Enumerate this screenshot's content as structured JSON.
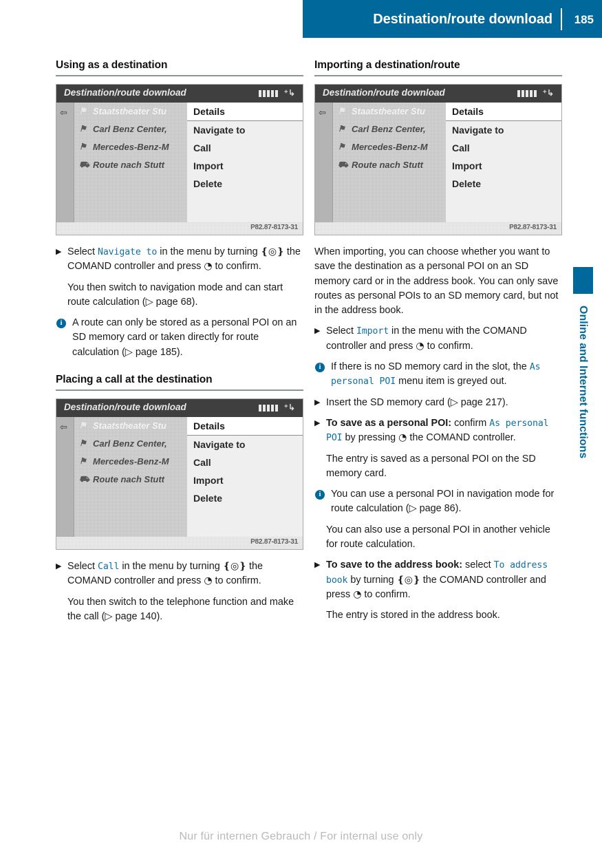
{
  "header": {
    "title": "Destination/route download",
    "page_number": "185"
  },
  "side_tab": {
    "label": "Online and Internet functions",
    "accent_color": "#00689b"
  },
  "screenshot_common": {
    "title": "Destination/route download",
    "image_id": "P82.87-8173-31",
    "back_icon": "back-arrow-icon",
    "roaming_icon": "roaming-icon",
    "list_items": [
      "Staatstheater Stu",
      "Carl Benz Center,",
      "Mercedes-Benz-M",
      "Route nach Stutt"
    ],
    "menu_items": [
      "Details",
      "Navigate to",
      "Call",
      "Import",
      "Delete"
    ]
  },
  "left_column": {
    "section1": {
      "heading": "Using as a destination",
      "step1": {
        "prefix": "Select ",
        "ui_term": "Navigate to",
        "mid1": " in the menu by turning ",
        "ctrl_turn": "❴◎❵",
        "mid2": " the COMAND controller and press ",
        "ctrl_press": "◔",
        "suffix": " to confirm."
      },
      "step1_detail": "You then switch to navigation mode and can start route calculation (▷ page 68).",
      "note1": "A route can only be stored as a personal POI on an SD memory card or taken directly for route calculation (▷ page 185)."
    },
    "section2": {
      "heading": "Placing a call at the destination",
      "step1": {
        "prefix": "Select ",
        "ui_term": "Call",
        "mid1": " in the menu by turning ",
        "ctrl_turn": "❴◎❵",
        "mid2": " the COMAND controller and press ",
        "ctrl_press": "◔",
        "suffix": " to confirm."
      },
      "step1_detail": "You then switch to the telephone function and make the call (▷ page 140)."
    }
  },
  "right_column": {
    "heading": "Importing a destination/route",
    "intro": "When importing, you can choose whether you want to save the destination as a personal POI on an SD memory card or in the address book. You can only save routes as personal POIs to an SD memory card, but not in the address book.",
    "step_import": {
      "prefix": "Select ",
      "ui_term": "Import",
      "mid1": " in the menu with the COMAND controller and press ",
      "ctrl_press": "◔",
      "suffix": " to confirm."
    },
    "note_no_card": {
      "prefix": "If there is no SD memory card in the slot, the ",
      "ui_term": "As personal POI",
      "suffix": " menu item is greyed out."
    },
    "step_insert_card": "Insert the SD memory card (▷ page 217).",
    "step_save_poi": {
      "bold_lead": "To save as a personal POI:",
      "mid0": " confirm ",
      "ui_term": "As personal POI",
      "mid1": " by pressing ",
      "ctrl_press": "◔",
      "suffix": " the COMAND controller."
    },
    "step_save_poi_detail": "The entry is saved as a personal POI on the SD memory card.",
    "note_use_poi": "You can use a personal POI in navigation mode for route calculation (▷ page 86).",
    "note_use_poi_detail": "You can also use a personal POI in another vehicle for route calculation.",
    "step_address_book": {
      "bold_lead": "To save to the address book:",
      "mid0": " select ",
      "ui_term": "To address book",
      "mid1": " by turning ",
      "ctrl_turn": "❴◎❵",
      "mid2": " the COMAND controller and press ",
      "ctrl_press": "◔",
      "suffix": " to confirm."
    },
    "step_address_book_detail": "The entry is stored in the address book."
  },
  "footer": {
    "watermark": "Nur für internen Gebrauch / For internal use only"
  }
}
